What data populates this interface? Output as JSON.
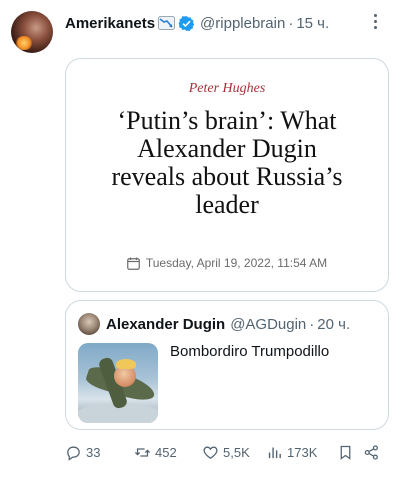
{
  "tweet": {
    "display_name": "Amerikanets",
    "handle": "@ripplebrain",
    "separator": "·",
    "time": "15 ч.",
    "name_badge_icon": "chart-decreasing-emoji-icon",
    "verified_icon": "verified-badge-icon",
    "verified_color": "#1d9bf0"
  },
  "article": {
    "author": "Peter Hughes",
    "title_lines": [
      "‘Putin’s brain’: What",
      "Alexander Dugin",
      "reveals about Russia’s",
      "leader"
    ],
    "date": "Tuesday, April 19, 2022, 11:54 AM",
    "date_icon": "calendar-icon",
    "author_color": "#a8323a"
  },
  "quote": {
    "name": "Alexander Dugin",
    "handle": "@AGDugin",
    "separator": "·",
    "time": "20 ч.",
    "text": "Bombordiro Trumpodillo"
  },
  "actions": {
    "reply_count": "33",
    "repost_count": "452",
    "like_count": "5,5K",
    "views_count": "173K"
  }
}
